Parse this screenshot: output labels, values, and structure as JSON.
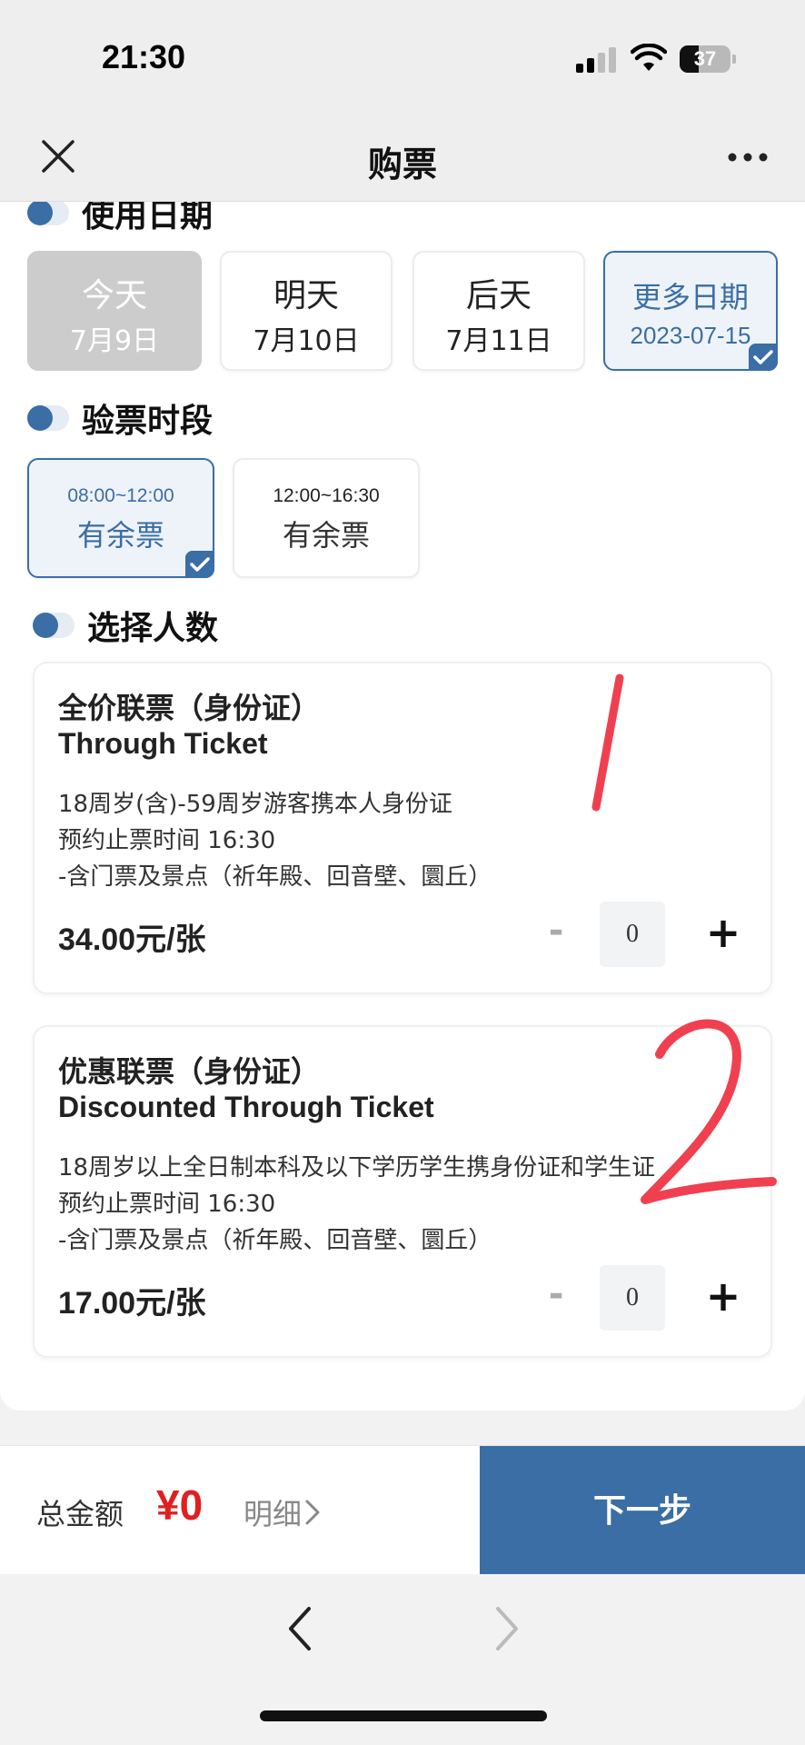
{
  "status_bar": {
    "time": "21:30",
    "battery": "37",
    "battery_level": 0.37
  },
  "header": {
    "title": "购票"
  },
  "date_section": {
    "title": "使用日期",
    "options": [
      {
        "line1": "今天",
        "line2": "7月9日",
        "state": "disabled"
      },
      {
        "line1": "明天",
        "line2": "7月10日",
        "state": "normal"
      },
      {
        "line1": "后天",
        "line2": "7月11日",
        "state": "normal"
      },
      {
        "line1": "更多日期",
        "line2": "2023-07-15",
        "state": "selected"
      }
    ]
  },
  "slot_section": {
    "title": "验票时段",
    "options": [
      {
        "time": "08:00~12:00",
        "status": "有余票",
        "state": "selected"
      },
      {
        "time": "12:00~16:30",
        "status": "有余票",
        "state": "normal"
      }
    ]
  },
  "people_section": {
    "title": "选择人数",
    "tickets": [
      {
        "name": "全价联票（身份证）",
        "name_en": "Through Ticket",
        "lines": [
          "18周岁(含)-59周岁游客携本人身份证",
          "预约止票时间 16:30",
          "-含门票及景点（祈年殿、回音壁、圜丘）"
        ],
        "price": "34.00元/张",
        "quantity": "0",
        "minus": "-",
        "plus": "+"
      },
      {
        "name": "优惠联票（身份证）",
        "name_en": "Discounted Through Ticket",
        "lines": [
          "18周岁以上全日制本科及以下学历学生携身份证和学生证",
          "预约止票时间 16:30",
          "-含门票及景点（祈年殿、回音壁、圜丘）"
        ],
        "price": "17.00元/张",
        "quantity": "0",
        "minus": "-",
        "plus": "+"
      }
    ]
  },
  "footer": {
    "total_label": "总金额",
    "total_amount": "¥0",
    "detail_label": "明细",
    "next_label": "下一步"
  },
  "colors": {
    "accent": "#3a6ea5",
    "price_red": "#e02020",
    "annotation_red": "#f04050",
    "disabled_gray": "#cccccc"
  },
  "icons": [
    "close-icon",
    "more-icon",
    "toggle-icon",
    "check-icon",
    "chevron-right-icon",
    "back-icon",
    "forward-icon",
    "signal-icon",
    "wifi-icon",
    "battery-icon"
  ]
}
